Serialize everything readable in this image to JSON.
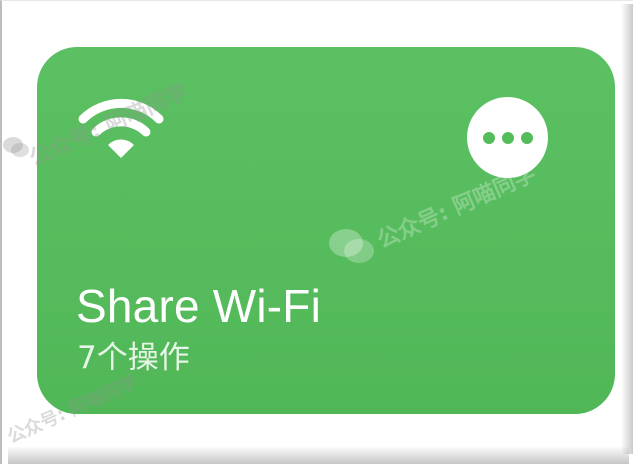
{
  "shortcut": {
    "title": "Share Wi-Fi",
    "subtitle": "7个操作",
    "icon": "wifi-icon",
    "menu_icon": "more-icon",
    "color": "#53bd5a"
  },
  "watermark": {
    "text": "公众号: 阿喵同学"
  }
}
